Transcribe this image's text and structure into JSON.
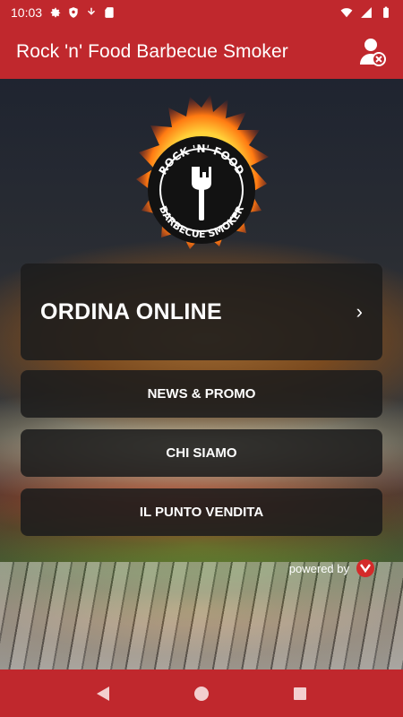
{
  "status_bar": {
    "time": "10:03",
    "icons_left": [
      "settings-icon",
      "shield-icon",
      "download-icon",
      "sd-card-icon"
    ],
    "icons_right": [
      "wifi-icon",
      "signal-icon",
      "battery-icon"
    ]
  },
  "app_bar": {
    "title": "Rock 'n' Food Barbecue Smoker",
    "user_icon": "user-blocked-icon"
  },
  "logo": {
    "text_top": "ROCK 'N' FOOD",
    "text_bottom": "BARBECUE SMOKER"
  },
  "menu": {
    "main": {
      "label": "ORDINA ONLINE",
      "chevron": "›"
    },
    "items": [
      {
        "label": "NEWS & PROMO"
      },
      {
        "label": "CHI SIAMO"
      },
      {
        "label": "IL PUNTO VENDITA"
      }
    ]
  },
  "footer": {
    "powered_label": "powered by"
  },
  "colors": {
    "primary": "#c0282d",
    "button_bg": "#1c1c1c",
    "text": "#ffffff"
  },
  "nav_bar": {
    "icons": [
      "back-icon",
      "home-icon",
      "recents-icon"
    ]
  }
}
